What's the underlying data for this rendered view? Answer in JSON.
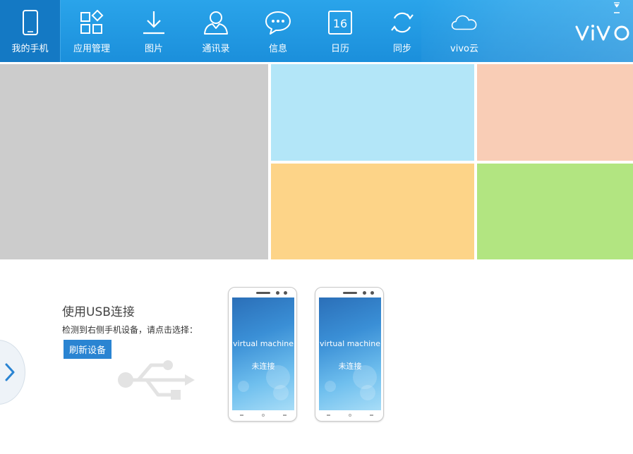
{
  "nav": {
    "items": [
      {
        "label": "我的手机",
        "icon": "phone-icon"
      },
      {
        "label": "应用管理",
        "icon": "app-grid-icon"
      },
      {
        "label": "图片",
        "icon": "download-icon"
      },
      {
        "label": "通讯录",
        "icon": "contact-icon"
      },
      {
        "label": "信息",
        "icon": "message-icon"
      },
      {
        "label": "日历",
        "icon": "calendar-icon",
        "icon_text": "16"
      },
      {
        "label": "同步",
        "icon": "sync-icon"
      },
      {
        "label": "vivo云",
        "icon": "cloud-icon"
      }
    ],
    "active_index": 0
  },
  "brand": {
    "logo_text": "vivo"
  },
  "tiles": {
    "colors": [
      "#cccccc",
      "#b3e6f8",
      "#f9cdb6",
      "#fdd488",
      "#b2e581"
    ]
  },
  "connect": {
    "title": "使用USB连接",
    "description": "检测到右侧手机设备，请点击选择：",
    "refresh_label": "刷新设备"
  },
  "devices": [
    {
      "name": "virtual machine",
      "status": "未连接"
    },
    {
      "name": "virtual machine",
      "status": "未连接"
    }
  ],
  "colors": {
    "topbar": "#1b8fdb",
    "active_tab": "#1479c4",
    "button": "#2a84d2"
  }
}
